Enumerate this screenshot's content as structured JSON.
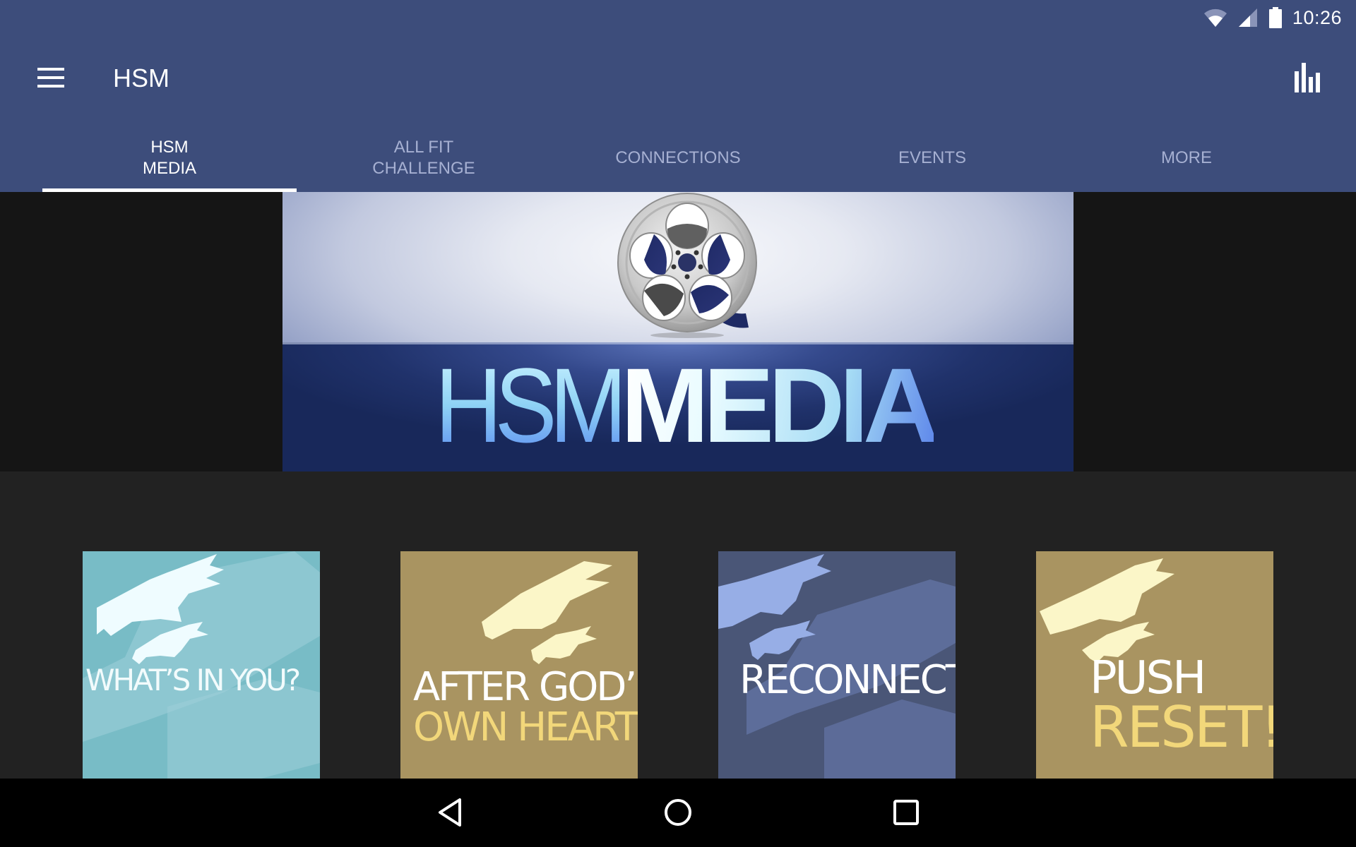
{
  "status_bar": {
    "time": "10:26",
    "icons": [
      "wifi-icon",
      "cell-signal-icon",
      "battery-icon"
    ]
  },
  "app_bar": {
    "title": "HSM",
    "menu_icon": "hamburger-menu-icon",
    "action_icon": "bar-chart-icon"
  },
  "tabs": [
    {
      "label": "HSM\nMEDIA",
      "active": true
    },
    {
      "label": "ALL FIT\nCHALLENGE",
      "active": false
    },
    {
      "label": "CONNECTIONS",
      "active": false
    },
    {
      "label": "EVENTS",
      "active": false
    },
    {
      "label": "MORE",
      "active": false
    }
  ],
  "banner": {
    "logo_icon": "film-reel-icon",
    "wordmark_thin": "HSM",
    "wordmark_bold": "MEDIA"
  },
  "tiles": [
    {
      "line1": "WHAT’S IN YOU?",
      "line2": "",
      "bg": "#78bcc6",
      "line1_color": "#f2fbfc",
      "line2_color": ""
    },
    {
      "line1": "AFTER GOD’S",
      "line2": "OWN HEART",
      "bg": "#a99461",
      "line1_color": "#ffffff",
      "line2_color": "#f2d77a"
    },
    {
      "line1": "RECONNECT",
      "line2": "",
      "bg": "#4a5677",
      "line1_color": "#ffffff",
      "line2_color": ""
    },
    {
      "line1": "PUSH",
      "line2": "RESET!",
      "bg": "#a99461",
      "line1_color": "#ffffff",
      "line2_color": "#f2d77a"
    }
  ],
  "nav_bar": {
    "back_icon": "back-triangle-icon",
    "home_icon": "home-circle-icon",
    "recents_icon": "recents-square-icon"
  },
  "colors": {
    "primary": "#3d4d7b",
    "tab_inactive": "#a6b0d2",
    "tab_active": "#ffffff",
    "content_bg": "#222222"
  }
}
